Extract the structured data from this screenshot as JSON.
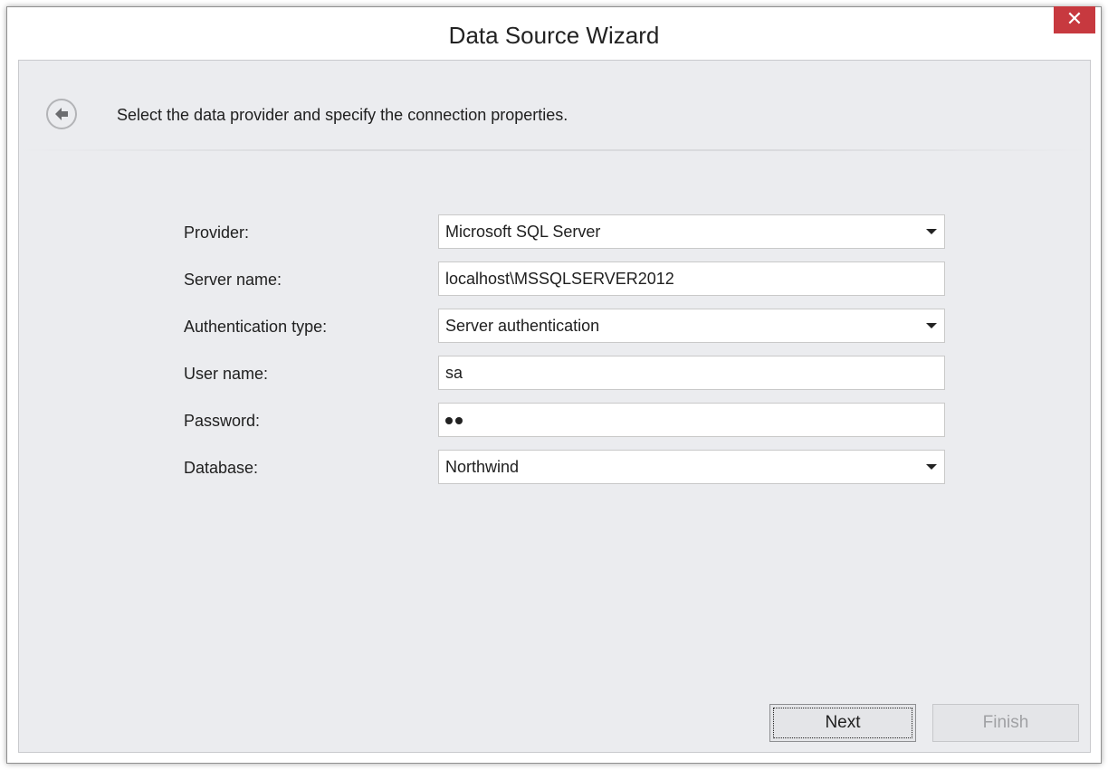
{
  "window": {
    "title": "Data Source Wizard",
    "close_glyph": "✕"
  },
  "header": {
    "instruction": "Select the data provider and specify the connection properties."
  },
  "form": {
    "provider": {
      "label": "Provider:",
      "value": "Microsoft SQL Server"
    },
    "server_name": {
      "label": "Server name:",
      "value": "localhost\\MSSQLSERVER2012"
    },
    "authentication_type": {
      "label": "Authentication type:",
      "value": "Server authentication"
    },
    "user_name": {
      "label": "User name:",
      "value": "sa"
    },
    "password": {
      "label": "Password:",
      "masked_length": 2
    },
    "database": {
      "label": "Database:",
      "value": "Northwind"
    }
  },
  "buttons": {
    "next": "Next",
    "finish": "Finish"
  },
  "colors": {
    "close_button": "#c7393f",
    "body_background": "#ebecef"
  }
}
